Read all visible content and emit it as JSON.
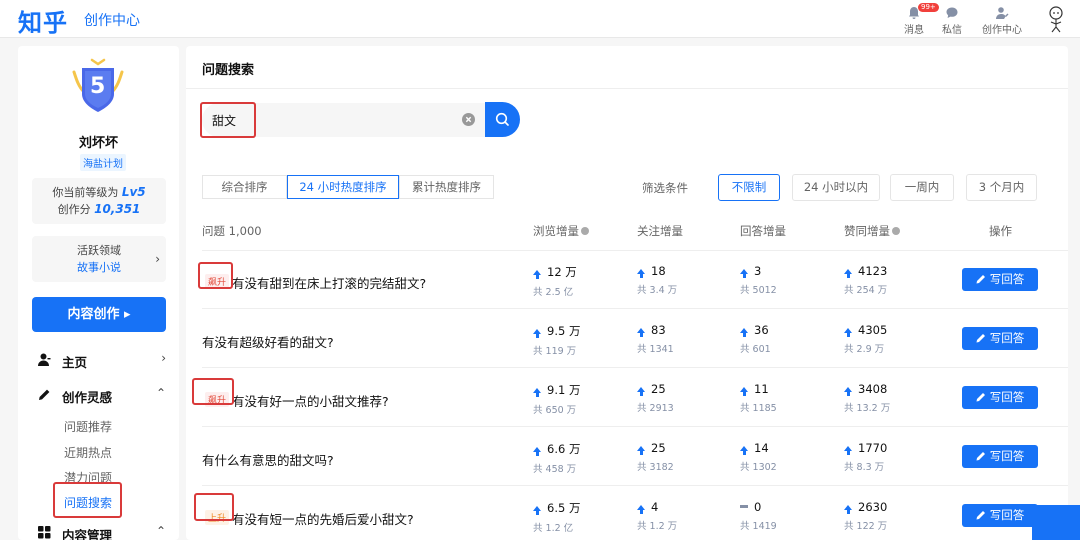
{
  "header": {
    "logo": "知乎",
    "subtitle": "创作中心",
    "items": [
      {
        "label": "消息",
        "badge": "99+"
      },
      {
        "label": "私信"
      },
      {
        "label": "创作中心"
      }
    ]
  },
  "sidebar": {
    "level_number": "5",
    "user_name": "刘坏坏",
    "plan": "海盐计划",
    "level_line": "你当前等级为",
    "level_value": "Lv5",
    "score_label": "创作分",
    "score_value": "10,351",
    "field_label": "活跃领域",
    "field_value": "故事小说",
    "create_button": "内容创作 ▸",
    "nav": [
      {
        "label": "主页",
        "chevron": "›"
      },
      {
        "label": "创作灵感",
        "chevron": "⌃"
      },
      {
        "label": "内容管理",
        "chevron": "⌃"
      }
    ],
    "sub_items": [
      "问题推荐",
      "近期热点",
      "潜力问题",
      "问题搜索"
    ]
  },
  "main": {
    "title": "问题搜索",
    "search_value": "甜文",
    "sort_tabs": [
      "综合排序",
      "24 小时热度排序",
      "累计热度排序"
    ],
    "filter_label": "筛选条件",
    "filters": [
      "不限制",
      "24 小时以内",
      "一周内",
      "3 个月内"
    ],
    "columns": [
      "问题 1,000",
      "浏览增量",
      "关注增量",
      "回答增量",
      "赞同增量",
      "操作"
    ],
    "answer_label": "写回答",
    "rows": [
      {
        "tag": "飙升",
        "tag_type": "hot",
        "title": "有没有甜到在床上打滚的完结甜文?",
        "views": "12 万",
        "views_total": "共 2.5 亿",
        "follows": "18",
        "follows_total": "共 3.4 万",
        "answers": "3",
        "answers_total": "共 5012",
        "answers_trend": "up",
        "likes": "4123",
        "likes_total": "共 254 万"
      },
      {
        "tag": "",
        "tag_type": "",
        "title": "有没有超级好看的甜文?",
        "views": "9.5 万",
        "views_total": "共 119 万",
        "follows": "83",
        "follows_total": "共 1341",
        "answers": "36",
        "answers_total": "共 601",
        "answers_trend": "up",
        "likes": "4305",
        "likes_total": "共 2.9 万"
      },
      {
        "tag": "飙升",
        "tag_type": "hot",
        "title": "有没有好一点的小甜文推荐?",
        "views": "9.1 万",
        "views_total": "共 650 万",
        "follows": "25",
        "follows_total": "共 2913",
        "answers": "11",
        "answers_total": "共 1185",
        "answers_trend": "up",
        "likes": "3408",
        "likes_total": "共 13.2 万"
      },
      {
        "tag": "",
        "tag_type": "",
        "title": "有什么有意思的甜文吗?",
        "views": "6.6 万",
        "views_total": "共 458 万",
        "follows": "25",
        "follows_total": "共 3182",
        "answers": "14",
        "answers_total": "共 1302",
        "answers_trend": "up",
        "likes": "1770",
        "likes_total": "共 8.3 万"
      },
      {
        "tag": "上升",
        "tag_type": "up",
        "title": "有没有短一点的先婚后爱小甜文?",
        "views": "6.5 万",
        "views_total": "共 1.2 亿",
        "follows": "4",
        "follows_total": "共 1.2 万",
        "answers": "0",
        "answers_total": "共 1419",
        "answers_trend": "flat",
        "likes": "2630",
        "likes_total": "共 122 万"
      }
    ]
  },
  "colors": {
    "brand": "#1772f6",
    "hot": "#e24a3b",
    "rising": "#f08a24",
    "annotation": "#d93a3a"
  }
}
